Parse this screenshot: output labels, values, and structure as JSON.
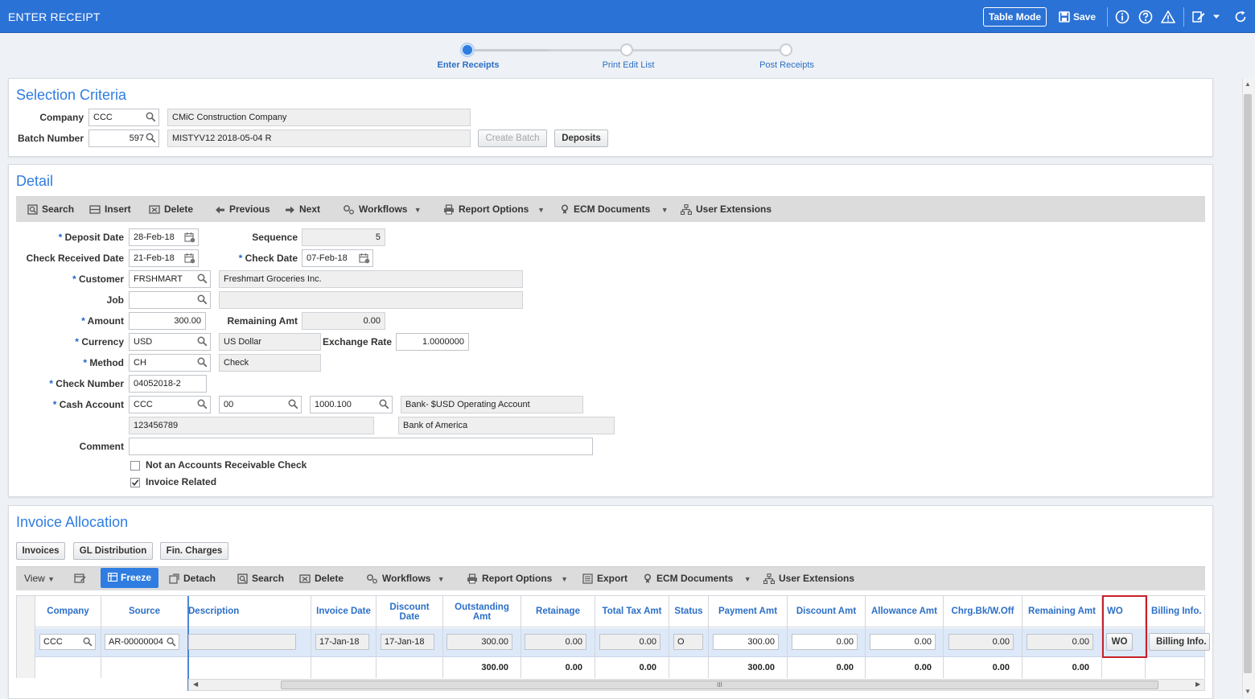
{
  "header": {
    "title": "ENTER RECEIPT",
    "table_mode_label": "Table Mode",
    "save_label": "Save"
  },
  "steps": [
    {
      "label": "Enter Receipts",
      "active": true
    },
    {
      "label": "Print Edit List",
      "active": false
    },
    {
      "label": "Post Receipts",
      "active": false
    }
  ],
  "selection": {
    "title": "Selection Criteria",
    "company_label": "Company",
    "company_value": "CCC",
    "company_name": "CMiC Construction Company",
    "batch_label": "Batch Number",
    "batch_value": "597",
    "batch_desc": "MISTYV12 2018-05-04 R",
    "create_batch_label": "Create Batch",
    "deposits_label": "Deposits"
  },
  "detail": {
    "title": "Detail",
    "toolbar": {
      "search": "Search",
      "insert": "Insert",
      "delete": "Delete",
      "previous": "Previous",
      "next": "Next",
      "workflows": "Workflows",
      "report_options": "Report Options",
      "ecm_documents": "ECM Documents",
      "user_extensions": "User Extensions"
    },
    "deposit_date_label": "Deposit Date",
    "deposit_date": "28-Feb-18",
    "sequence_label": "Sequence",
    "sequence": "5",
    "check_received_label": "Check Received Date",
    "check_received": "21-Feb-18",
    "check_date_label": "Check Date",
    "check_date": "07-Feb-18",
    "customer_label": "Customer",
    "customer": "FRSHMART",
    "customer_name": "Freshmart Groceries Inc.",
    "job_label": "Job",
    "job": "",
    "job_name": "",
    "amount_label": "Amount",
    "amount": "300.00",
    "remaining_label": "Remaining Amt",
    "remaining": "0.00",
    "currency_label": "Currency",
    "currency": "USD",
    "currency_name": "US Dollar",
    "exchange_label": "Exchange Rate",
    "exchange": "1.0000000",
    "method_label": "Method",
    "method": "CH",
    "method_name": "Check",
    "check_number_label": "Check Number",
    "check_number": "04052018-2",
    "cash_account_label": "Cash Account",
    "cash_co": "CCC",
    "cash_dept": "00",
    "cash_acct": "1000.100",
    "cash_acct_name": "Bank- $USD Operating Account",
    "bank_account_no": "123456789",
    "bank_name": "Bank of America",
    "comment_label": "Comment",
    "comment": "",
    "not_ar_label": "Not an Accounts Receivable Check",
    "not_ar_checked": false,
    "invoice_related_label": "Invoice Related",
    "invoice_related_checked": true,
    "required_mark": "*"
  },
  "allocation": {
    "title": "Invoice Allocation",
    "tabs": [
      "Invoices",
      "GL Distribution",
      "Fin. Charges"
    ],
    "toolbar": {
      "view": "View",
      "freeze": "Freeze",
      "detach": "Detach",
      "search": "Search",
      "delete": "Delete",
      "workflows": "Workflows",
      "report_options": "Report Options",
      "export": "Export",
      "ecm_documents": "ECM Documents",
      "user_extensions": "User Extensions"
    },
    "columns": {
      "company": "Company",
      "source": "Source",
      "description": "Description",
      "invoice_date": "Invoice Date",
      "discount_date": "Discount Date",
      "outstanding": "Outstanding Amt",
      "retainage": "Retainage",
      "total_tax": "Total Tax Amt",
      "status": "Status",
      "payment": "Payment Amt",
      "discount": "Discount Amt",
      "allowance": "Allowance Amt",
      "chrg": "Chrg.Bk/W.Off",
      "remaining": "Remaining Amt",
      "wo": "WO",
      "billing": "Billing Info."
    },
    "row": {
      "company": "CCC",
      "source": "AR-00000004",
      "description": "",
      "invoice_date": "17-Jan-18",
      "discount_date": "17-Jan-18",
      "outstanding": "300.00",
      "retainage": "0.00",
      "total_tax": "0.00",
      "status": "O",
      "payment": "300.00",
      "discount": "0.00",
      "allowance": "0.00",
      "chrg": "0.00",
      "remaining": "0.00",
      "wo_button": "WO",
      "billing_button": "Billing Info."
    },
    "totals": {
      "outstanding": "300.00",
      "retainage": "0.00",
      "total_tax": "0.00",
      "payment": "300.00",
      "discount": "0.00",
      "allowance": "0.00",
      "chrg": "0.00",
      "remaining": "0.00"
    },
    "scroll_grip": "III"
  },
  "colors": {
    "topbar": "#2b72d6",
    "accent": "#2f7de1",
    "highlight_box": "#c8202b"
  }
}
